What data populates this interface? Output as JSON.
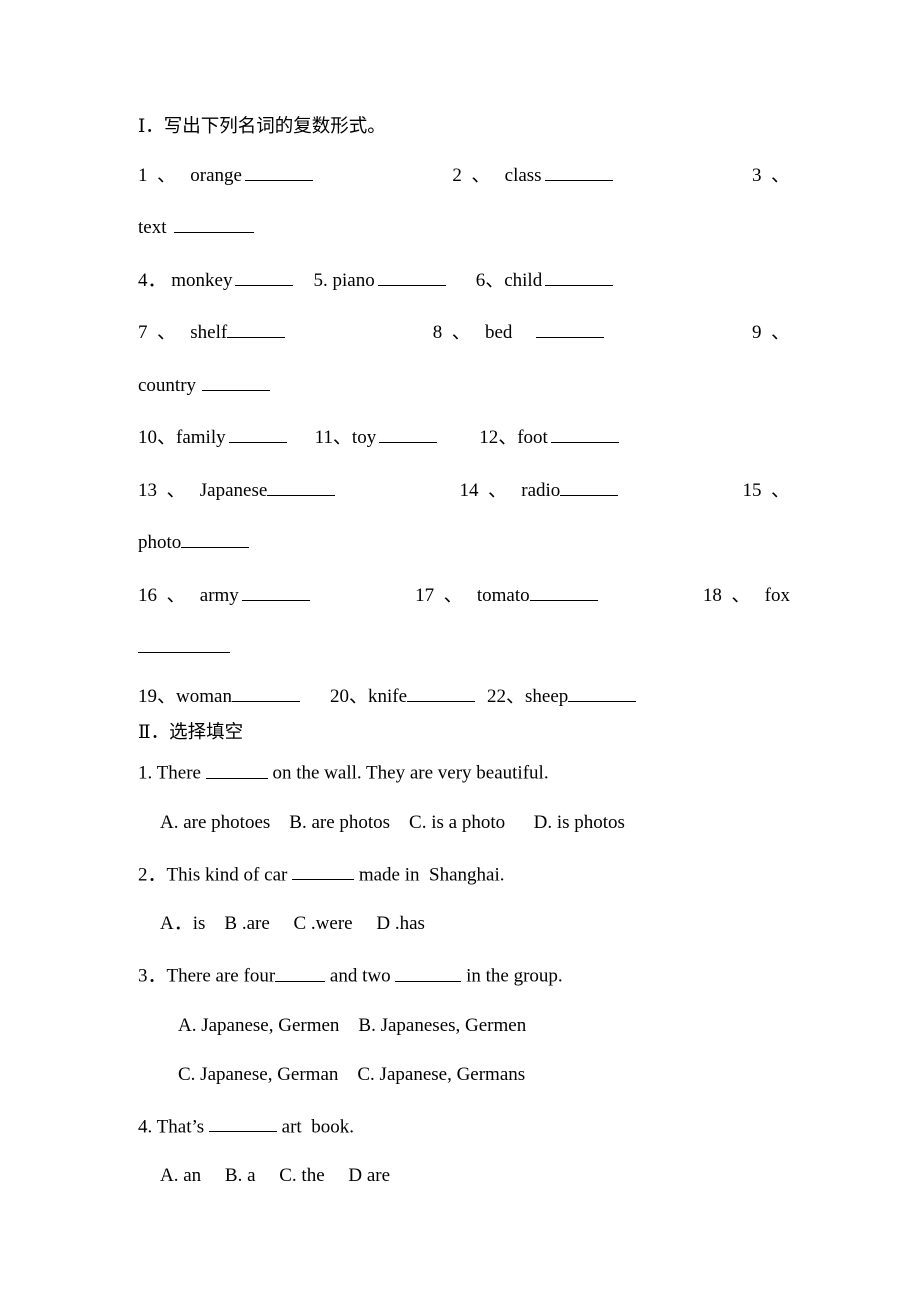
{
  "document": {
    "section1": {
      "heading": "Ⅰ．写出下列名词的复数形式。",
      "rows": [
        {
          "items": [
            {
              "num": "1  、",
              "word": "orange",
              "blank": "b-md"
            },
            {
              "num": "2  、",
              "word": "class",
              "blank": "b-md"
            },
            {
              "num": "3  、",
              "word": "",
              "blank": ""
            }
          ]
        },
        {
          "items": [
            {
              "num": "",
              "word": "text",
              "blank": "b-lg"
            }
          ]
        },
        {
          "items": [
            {
              "num": "4．",
              "word": "monkey",
              "blank": "b-sm"
            },
            {
              "num": "5. ",
              "word": "piano",
              "blank": "b-md"
            },
            {
              "num": "6、",
              "word": "child",
              "blank": "b-md"
            }
          ]
        },
        {
          "items": [
            {
              "num": "7  、",
              "word": "shelf",
              "blank": "b-sm"
            },
            {
              "num": "8  、",
              "word": "bed",
              "blank": "b-md"
            },
            {
              "num": "9  、",
              "word": "",
              "blank": ""
            }
          ]
        },
        {
          "items": [
            {
              "num": "",
              "word": "country",
              "blank": "b-md"
            }
          ]
        },
        {
          "items": [
            {
              "num": "10、",
              "word": "family",
              "blank": "b-sm"
            },
            {
              "num": "11、",
              "word": "toy",
              "blank": "b-sm"
            },
            {
              "num": "12、",
              "word": "foot",
              "blank": "b-md"
            }
          ]
        },
        {
          "items": [
            {
              "num": "13  、",
              "word": "Japanese",
              "blank": "b-md"
            },
            {
              "num": "14  、",
              "word": "radio",
              "blank": "b-sm"
            },
            {
              "num": "15  、",
              "word": "",
              "blank": ""
            }
          ]
        },
        {
          "items": [
            {
              "num": "",
              "word": "photo",
              "blank": "b-md"
            }
          ]
        },
        {
          "items": [
            {
              "num": "16  、",
              "word": "army",
              "blank": "b-md"
            },
            {
              "num": "17  、",
              "word": "tomato",
              "blank": "b-md"
            },
            {
              "num": "18  、",
              "word": "fox",
              "blank": ""
            }
          ]
        },
        {
          "items": [
            {
              "num": "",
              "word": "",
              "blank": "b-xl"
            }
          ]
        },
        {
          "items": [
            {
              "num": "19、",
              "word": "woman",
              "blank": "b-md"
            },
            {
              "num": "20、",
              "word": "knife",
              "blank": "b-md"
            },
            {
              "num": "22、",
              "word": "sheep",
              "blank": "b-md"
            }
          ]
        }
      ]
    },
    "section2": {
      "heading": "Ⅱ．选择填空",
      "questions": [
        {
          "stem_before": "1. There ",
          "stem_after": " on the wall. They are very beautiful.",
          "options_line1": "A. are photoes    B. are photos    C. is a photo      D. is photos",
          "options_line2": ""
        },
        {
          "stem_before": "2．This kind of car ",
          "stem_after": " made in  Shanghai.",
          "options_line1": "A．is    B .are     C .were     D .has",
          "options_line2": ""
        },
        {
          "stem_before": "3．There are four",
          "stem_mid": " and two ",
          "stem_after": " in the group.",
          "options_line1": "A. Japanese, Germen    B. Japaneses, Germen",
          "options_line2": "C. Japanese, German    C. Japanese, Germans"
        },
        {
          "stem_before": "4. That’s ",
          "stem_after": " art  book.",
          "options_line1": "A. an     B. a     C. the     D are",
          "options_line2": ""
        }
      ]
    }
  }
}
